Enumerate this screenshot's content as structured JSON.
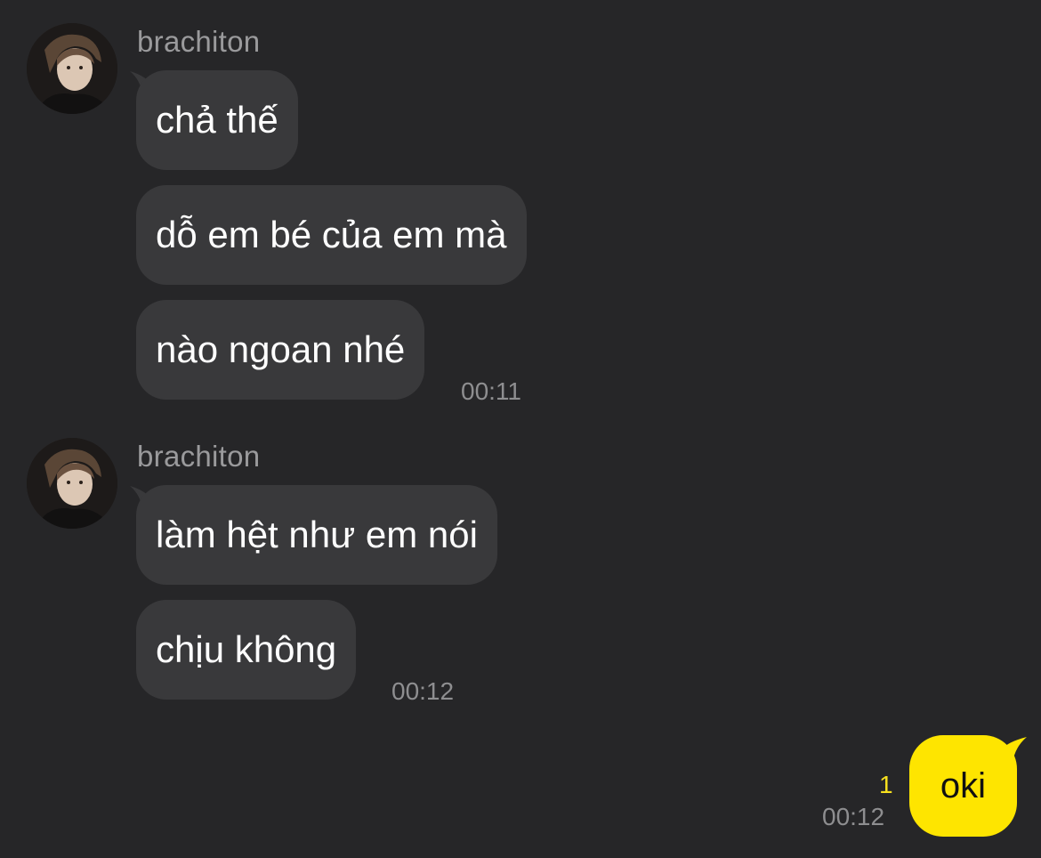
{
  "colors": {
    "background": "#262628",
    "incoming_bubble": "#39393b",
    "outgoing_bubble": "#fee500",
    "timestamp": "#8e8e90",
    "unread": "#f7e01e",
    "sender_name": "#9a9a9c"
  },
  "groups": [
    {
      "sender": "brachiton",
      "avatar_icon": "profile-photo-icon",
      "messages": [
        "chả thế",
        "dỗ em bé của em mà",
        "nào ngoan nhé"
      ],
      "time": "00:11"
    },
    {
      "sender": "brachiton",
      "avatar_icon": "profile-photo-icon",
      "messages": [
        "làm hệt như em nói",
        "chịu không"
      ],
      "time": "00:12"
    }
  ],
  "outgoing": {
    "message": "oki",
    "unread_count": "1",
    "time": "00:12"
  }
}
